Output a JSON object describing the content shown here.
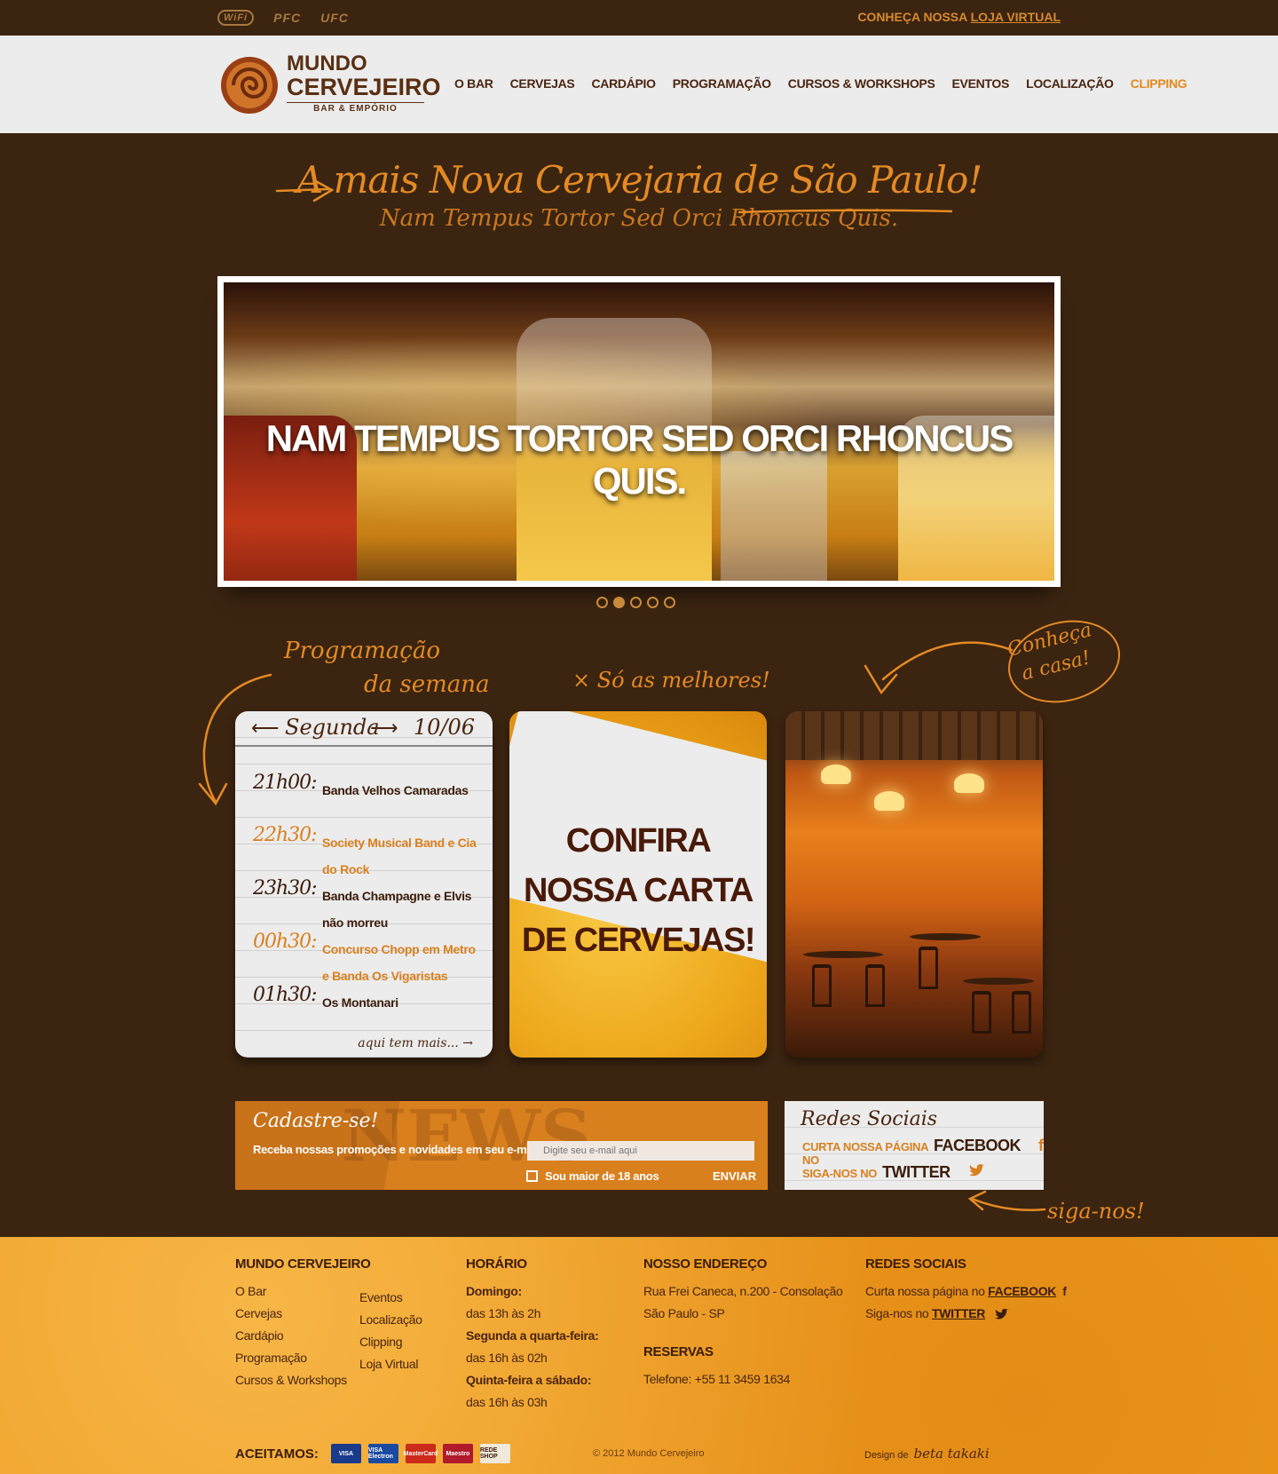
{
  "topbar": {
    "brands": [
      "WiFi",
      "PFC",
      "UFC"
    ],
    "store_prefix": "CONHEÇA NOSSA ",
    "store_link": "LOJA VIRTUAL"
  },
  "header": {
    "logo_line1": "MUNDO",
    "logo_line2": "CERVEJEIRO",
    "logo_line3": "BAR & EMPÓRIO",
    "nav": [
      "O BAR",
      "CERVEJAS",
      "CARDÁPIO",
      "PROGRAMAÇÃO",
      "CURSOS & WORKSHOPS",
      "EVENTOS",
      "LOCALIZAÇÃO",
      "CLIPPING"
    ],
    "active_nav": "CLIPPING"
  },
  "hero": {
    "title": "A mais Nova Cervejaria de São Paulo!",
    "subtitle": "Nam Tempus Tortor Sed Orci Rhoncus Quis."
  },
  "slider": {
    "caption": "NAM TEMPUS TORTOR SED ORCI RHONCUS QUIS.",
    "dot_count": 5,
    "active_dot": 1
  },
  "annotations": {
    "prog_line1": "Programação",
    "prog_line2": "da semana",
    "best": "× Só as melhores!",
    "casa_line1": "Conheça",
    "casa_line2": "a casa!",
    "siga": "siga-nos!"
  },
  "schedule": {
    "day": "Segunda",
    "date": "10/06",
    "more": "aqui tem mais...",
    "items": [
      {
        "time": "21h00:",
        "band": "Banda Velhos Camaradas"
      },
      {
        "time": "22h30:",
        "band": "Society Musical Band e Cia do Rock"
      },
      {
        "time": "23h30:",
        "band": "Banda Champagne e Elvis não morreu"
      },
      {
        "time": "00h30:",
        "band": "Concurso Chopp em Metro e Banda Os Vigaristas"
      },
      {
        "time": "01h30:",
        "band": "Os Montanari"
      }
    ]
  },
  "beer_card": {
    "line1": "CONFIRA",
    "line2": "NOSSA CARTA",
    "line3": "DE CERVEJAS!"
  },
  "newsletter": {
    "title": "Cadastre-se!",
    "subtitle": "Receba nossas promoções e novidades em seu e-mail.",
    "placeholder": "Digite seu e-mail aqui",
    "checkbox_label": "Sou maior de 18 anos",
    "submit": "ENVIAR",
    "bg_word": "NEWS"
  },
  "social": {
    "title": "Redes Sociais",
    "facebook_pre": "CURTA NOSSA PÁGINA NO",
    "facebook": "FACEBOOK",
    "twitter_pre": "SIGA-NOS NO",
    "twitter": "TWITTER"
  },
  "footer": {
    "col1_title": "MUNDO CERVEJEIRO",
    "col1_links": [
      "O Bar",
      "Cervejas",
      "Cardápio",
      "Programação",
      "Cursos & Workshops"
    ],
    "col1b_links": [
      "Eventos",
      "Localização",
      "Clipping",
      "Loja Virtual"
    ],
    "hours_title": "HORÁRIO",
    "hours": [
      {
        "day": "Domingo:",
        "time": "das 13h às 2h"
      },
      {
        "day": "Segunda a quarta-feira:",
        "time": "das 16h às 02h"
      },
      {
        "day": "Quinta-feira a sábado:",
        "time": "das 16h às 03h"
      }
    ],
    "address_title": "NOSSO ENDEREÇO",
    "address_line1": "Rua Frei Caneca, n.200 - Consolação",
    "address_line2": "São Paulo - SP",
    "reservas_title": "RESERVAS",
    "phone": "Telefone: +55 11 3459 1634",
    "social_title": "REDES SOCIAIS",
    "fb_pre": "Curta nossa página no ",
    "fb_link": "FACEBOOK",
    "tw_pre": "Siga-nos no ",
    "tw_link": "TWITTER",
    "accept_label": "ACEITAMOS:",
    "cards": [
      "VISA",
      "VISA Electron",
      "MasterCard",
      "Maestro",
      "REDE SHOP"
    ],
    "copyright": "© 2012 Mundo Cervejeiro",
    "credit_pre": "Design de",
    "credit_name": "beta takaki"
  },
  "colors": {
    "background": "#3b2410",
    "accent_orange": "#e48a24",
    "footer_orange": "#ee9a1f",
    "dark_brown": "#4a2510"
  }
}
